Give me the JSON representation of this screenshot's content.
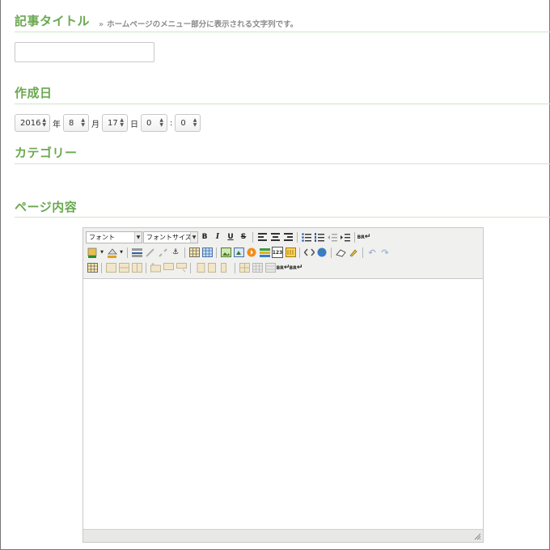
{
  "title_section": {
    "label": "記事タイトル",
    "hint_marker": "»",
    "hint": "ホームページのメニュー部分に表示される文字列です。",
    "value": ""
  },
  "date_section": {
    "label": "作成日",
    "year": "2016",
    "year_unit": "年",
    "month": "8",
    "month_unit": "月",
    "day": "17",
    "day_unit": "日",
    "hour": "0",
    "separator": ":",
    "minute": "0"
  },
  "category_section": {
    "label": "カテゴリー"
  },
  "content_section": {
    "label": "ページ内容"
  },
  "editor": {
    "font_label": "フォント",
    "font_size_label": "フォントサイズ",
    "bold": "B",
    "italic": "I",
    "underline": "U",
    "strike": "S",
    "br": "BR"
  },
  "colors": {
    "accent": "#6aa84f",
    "rule": "#cfe5c7"
  }
}
